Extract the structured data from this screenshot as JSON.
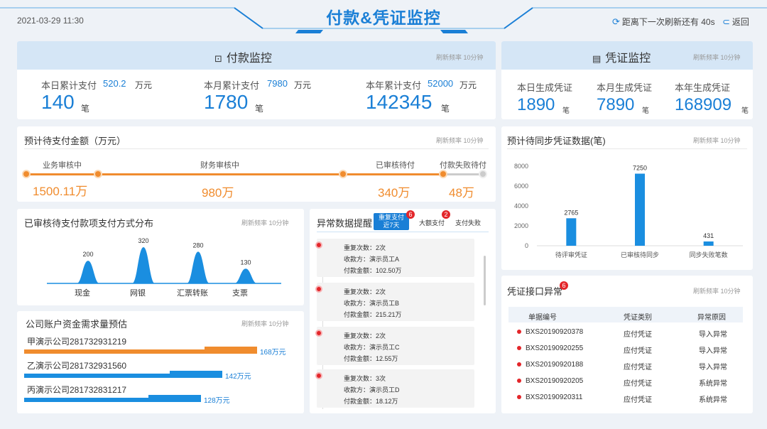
{
  "header": {
    "datetime": "2021-03-29 11:30",
    "title": "付款&凭证监控",
    "refresh_text": "距离下一次刷新还有 40s",
    "back_label": "返回"
  },
  "freq_label": "刷新频率 10分钟",
  "payment": {
    "title": "付款监控",
    "stats": [
      {
        "label": "本日累计支付",
        "sub": "520.2",
        "sub_unit": "万元",
        "value": "140",
        "unit": "笔"
      },
      {
        "label": "本月累计支付",
        "sub": "7980",
        "sub_unit": "万元",
        "value": "1780",
        "unit": "笔"
      },
      {
        "label": "本年累计支付",
        "sub": "52000",
        "sub_unit": "万元",
        "value": "142345",
        "unit": "笔"
      }
    ]
  },
  "voucher": {
    "title": "凭证监控",
    "stats": [
      {
        "label": "本日生成凭证",
        "value": "1890",
        "unit": "笔"
      },
      {
        "label": "本月生成凭证",
        "value": "7890",
        "unit": "笔"
      },
      {
        "label": "本年生成凭证",
        "value": "168909",
        "unit": "笔"
      }
    ]
  },
  "pending": {
    "title": "预计待支付金额（万元）",
    "stages": [
      {
        "label": "业务审核中",
        "value": "1500.11万"
      },
      {
        "label": "财务审核中",
        "value": "980万"
      },
      {
        "label": "已审核待付",
        "value": "340万"
      },
      {
        "label": "付款失败待付",
        "value": "48万"
      }
    ]
  },
  "sync_chart": {
    "title": "预计待同步凭证数据(笔)"
  },
  "method_chart": {
    "title": "已审核待支付款项支付方式分布"
  },
  "anomaly": {
    "title": "异常数据提醒",
    "tabs": [
      {
        "label": "重复支付",
        "sub": "近7天",
        "badge": "6"
      },
      {
        "label": "大额支付",
        "badge": "2"
      },
      {
        "label": "支付失败"
      }
    ],
    "items": [
      {
        "count": "重复次数：2次",
        "payee": "收款方：演示员工A",
        "amount": "付款金额：102.50万"
      },
      {
        "count": "重复次数：2次",
        "payee": "收款方：演示员工B",
        "amount": "付款金额：215.21万"
      },
      {
        "count": "重复次数：2次",
        "payee": "收款方：演示员工C",
        "amount": "付款金额：12.55万"
      },
      {
        "count": "重复次数：3次",
        "payee": "收款方：演示员工D",
        "amount": "付款金额：18.12万"
      }
    ]
  },
  "funds": {
    "title": "公司账户资金需求量预估",
    "rows": [
      {
        "name": "甲演示公司281732931219",
        "value": "168万元",
        "fraction": 1.0,
        "color": "#f08c2e"
      },
      {
        "name": "乙演示公司281732931560",
        "value": "142万元",
        "fraction": 0.85,
        "color": "#1a8ee0"
      },
      {
        "name": "丙演示公司281732831217",
        "value": "128万元",
        "fraction": 0.76,
        "color": "#1a8ee0"
      }
    ]
  },
  "voucher_err": {
    "title": "凭证接口异常",
    "badge": "6",
    "headers": [
      "单据编号",
      "凭证类别",
      "异常原因"
    ],
    "rows": [
      [
        "BXS20190920378",
        "应付凭证",
        "导入异常"
      ],
      [
        "BXS20190920255",
        "应付凭证",
        "导入异常"
      ],
      [
        "BXS20190920188",
        "应付凭证",
        "导入异常"
      ],
      [
        "BXS20190920205",
        "应付凭证",
        "系统异常"
      ],
      [
        "BXS20190920311",
        "应付凭证",
        "系统异常"
      ]
    ]
  },
  "chart_data": [
    {
      "type": "bar",
      "title": "预计待同步凭证数据(笔)",
      "categories": [
        "待评审凭证",
        "已审核待同步",
        "同步失败笔数"
      ],
      "values": [
        2765,
        7250,
        431
      ],
      "ylim": [
        0,
        8000
      ],
      "yticks": [
        0,
        2000,
        4000,
        6000,
        8000
      ],
      "color": "#1a8ee0"
    },
    {
      "type": "area",
      "title": "已审核待支付款项支付方式分布",
      "categories": [
        "现金",
        "网银",
        "汇票转账",
        "支票"
      ],
      "values": [
        200,
        320,
        280,
        130
      ],
      "color": "#1a8ee0"
    }
  ]
}
